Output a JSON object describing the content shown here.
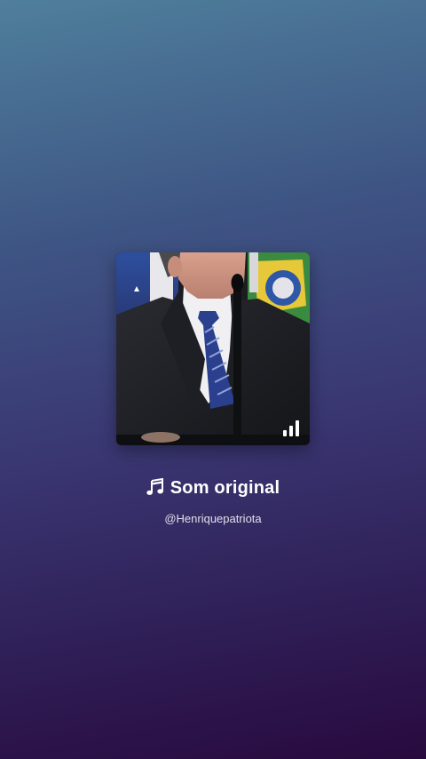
{
  "sound": {
    "title": "Som original",
    "author": "@Henriquepatriota",
    "cover_icon": "video-thumbnail",
    "playing_icon": "audio-bars-icon",
    "note_icon": "music-note-icon"
  },
  "colors": {
    "background_top": "#4f7f9c",
    "background_bottom": "#280a3e",
    "text": "#ffffff"
  }
}
